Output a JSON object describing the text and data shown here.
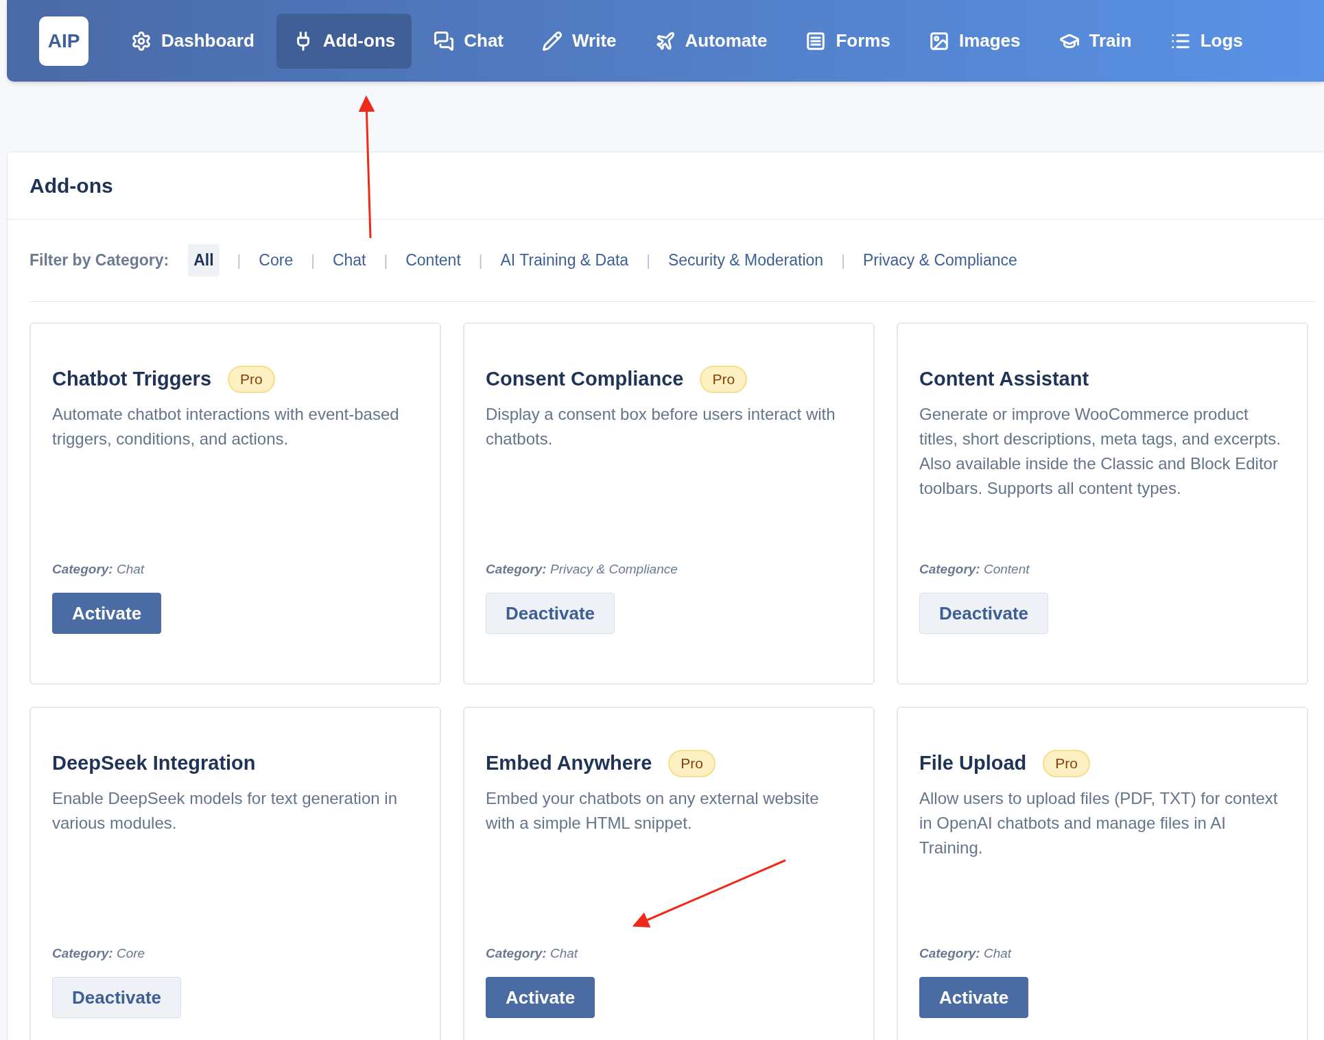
{
  "logo": "AIP",
  "nav": [
    {
      "label": "Dashboard",
      "selected": false
    },
    {
      "label": "Add-ons",
      "selected": true
    },
    {
      "label": "Chat",
      "selected": false
    },
    {
      "label": "Write",
      "selected": false
    },
    {
      "label": "Automate",
      "selected": false
    },
    {
      "label": "Forms",
      "selected": false
    },
    {
      "label": "Images",
      "selected": false
    },
    {
      "label": "Train",
      "selected": false
    },
    {
      "label": "Logs",
      "selected": false
    }
  ],
  "title": "Add-ons",
  "filter": {
    "label": "Filter by Category:",
    "options": [
      {
        "label": "All",
        "selected": true
      },
      {
        "label": "Core",
        "selected": false
      },
      {
        "label": "Chat",
        "selected": false
      },
      {
        "label": "Content",
        "selected": false
      },
      {
        "label": "AI Training & Data",
        "selected": false
      },
      {
        "label": "Security & Moderation",
        "selected": false
      },
      {
        "label": "Privacy & Compliance",
        "selected": false
      }
    ],
    "separator": "|"
  },
  "cards": [
    {
      "title": "Chatbot Triggers",
      "badge": "Pro",
      "description": "Automate chatbot interactions with event-based triggers, conditions, and actions.",
      "category_label": "Category:",
      "category": "Chat",
      "button": {
        "label": "Activate",
        "kind": "primary"
      }
    },
    {
      "title": "Consent Compliance",
      "badge": "Pro",
      "description": "Display a consent box before users interact with chatbots.",
      "category_label": "Category:",
      "category": "Privacy & Compliance",
      "button": {
        "label": "Deactivate",
        "kind": "secondary"
      }
    },
    {
      "title": "Content Assistant",
      "description": "Generate or improve WooCommerce product titles, short descriptions, meta tags, and excerpts. Also available inside the Classic and Block Editor toolbars. Supports all content types.",
      "category_label": "Category:",
      "category": "Content",
      "button": {
        "label": "Deactivate",
        "kind": "secondary"
      }
    },
    {
      "title": "DeepSeek Integration",
      "description": "Enable DeepSeek models for text generation in various modules.",
      "category_label": "Category:",
      "category": "Core",
      "button": {
        "label": "Deactivate",
        "kind": "secondary"
      }
    },
    {
      "title": "Embed Anywhere",
      "badge": "Pro",
      "description": "Embed your chatbots on any external website with a simple HTML snippet.",
      "category_label": "Category:",
      "category": "Chat",
      "button": {
        "label": "Activate",
        "kind": "primary"
      }
    },
    {
      "title": "File Upload",
      "badge": "Pro",
      "description": "Allow users to upload files (PDF, TXT) for context in OpenAI chatbots and manage files in AI Training.",
      "category_label": "Category:",
      "category": "Chat",
      "button": {
        "label": "Activate",
        "kind": "primary"
      }
    }
  ]
}
